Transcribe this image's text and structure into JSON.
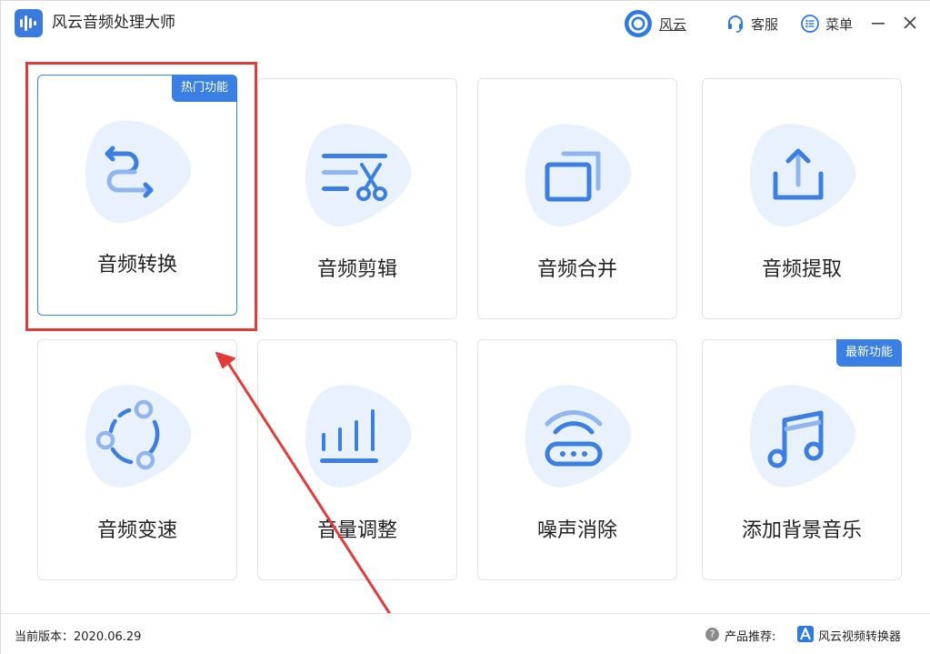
{
  "app": {
    "title": "风云音频处理大师"
  },
  "titlebar": {
    "user_label": "风云",
    "service_label": "客服",
    "menu_label": "菜单"
  },
  "cards": [
    {
      "id": "convert",
      "label": "音频转换",
      "badge": "热门功能",
      "icon": "swap-arrows-icon"
    },
    {
      "id": "cut",
      "label": "音频剪辑",
      "badge": "",
      "icon": "scissors-list-icon"
    },
    {
      "id": "merge",
      "label": "音频合并",
      "badge": "",
      "icon": "merge-squares-icon"
    },
    {
      "id": "extract",
      "label": "音频提取",
      "badge": "",
      "icon": "upload-tray-icon"
    },
    {
      "id": "speed",
      "label": "音频变速",
      "badge": "",
      "icon": "circle-nodes-icon"
    },
    {
      "id": "volume",
      "label": "音量调整",
      "badge": "",
      "icon": "volume-bars-icon"
    },
    {
      "id": "denoise",
      "label": "噪声消除",
      "badge": "",
      "icon": "router-wifi-icon"
    },
    {
      "id": "bgm",
      "label": "添加背景音乐",
      "badge": "最新功能",
      "icon": "music-note-icon"
    }
  ],
  "footer": {
    "version_text": "当前版本：2020.06.29",
    "recommend_label": "产品推荐:",
    "recommend_product": "风云视频转换器"
  },
  "colors": {
    "accent": "#3a7fe4",
    "icon_blue": "#3b7fe3",
    "blob": "#e9f1fd",
    "annotation_red": "#e23b3b"
  }
}
